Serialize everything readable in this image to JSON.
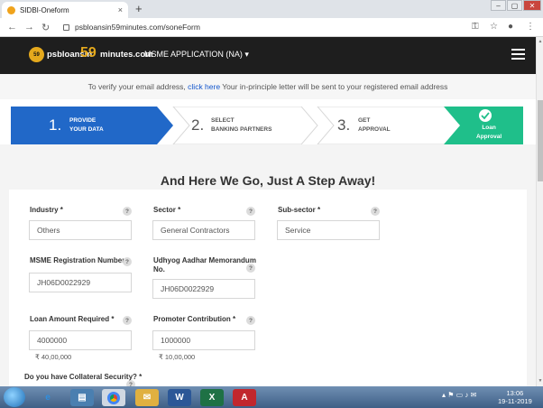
{
  "browser": {
    "tab_title": "SIDBI-Oneform",
    "tab_close": "×",
    "new_tab": "+",
    "url": "psbloansin59minutes.com/soneForm"
  },
  "header": {
    "logo_badge": "59",
    "logo_part1": "psbloansin",
    "logo_part2": "59",
    "logo_part3": "minutes.com",
    "app_menu": "MSME APPLICATION (NA)",
    "app_menu_caret": "▾"
  },
  "verify": {
    "prefix": "To verify your email address,",
    "link": "click here",
    "suffix": "Your in-principle letter will be sent to your registered email address"
  },
  "steps": [
    {
      "num": "1.",
      "line1": "PROVIDE",
      "line2": "YOUR DATA"
    },
    {
      "num": "2.",
      "line1": "SELECT",
      "line2": "BANKING PARTNERS"
    },
    {
      "num": "3.",
      "line1": "GET",
      "line2": "APPROVAL"
    },
    {
      "num": "",
      "line1": "Loan",
      "line2": "Approval"
    }
  ],
  "page": {
    "heading": "And Here We Go, Just A Step Away!"
  },
  "form": {
    "help_glyph": "?",
    "industry": {
      "label": "Industry *",
      "value": "Others"
    },
    "sector": {
      "label": "Sector *",
      "value": "General Contractors"
    },
    "subsector": {
      "label": "Sub-sector *",
      "value": "Service"
    },
    "msme_reg": {
      "label": "MSME Registration Number",
      "value": "JH06D0022929"
    },
    "udhyog": {
      "label_line1": "Udhyog Aadhar Memorandum",
      "label_line2": "No.",
      "value": "JH06D0022929"
    },
    "loan_amount": {
      "label": "Loan Amount Required *",
      "value": "4000000",
      "hint": "₹ 40,00,000"
    },
    "promoter": {
      "label": "Promoter Contribution *",
      "value": "1000000",
      "hint": "₹ 10,00,000"
    },
    "collateral": {
      "label": "Do you have Collateral Security? *"
    }
  },
  "taskbar": {
    "clock_time": "13:06",
    "clock_date": "19-11-2019"
  }
}
